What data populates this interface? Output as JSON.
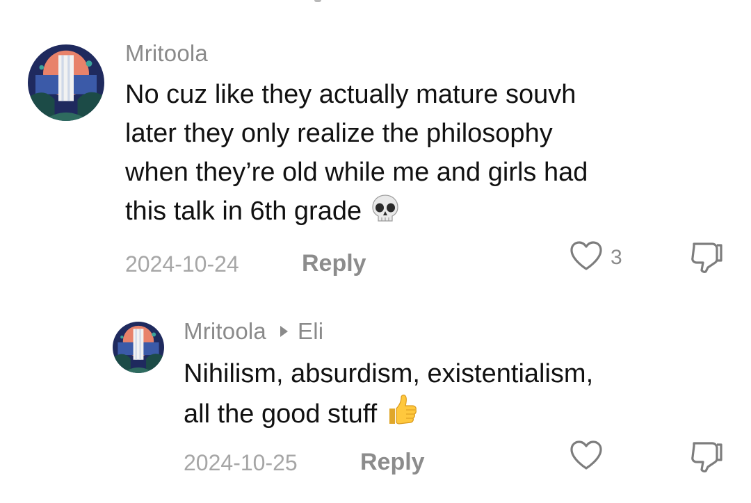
{
  "comment": {
    "username": "Mritoola",
    "text_lines": [
      "No cuz like they actually mature souvh",
      "later they only realize the philosophy",
      "when they’re old while me and girls had",
      "this talk in 6th grade"
    ],
    "emoji": "skull-emoji",
    "date": "2024-10-24",
    "reply_label": "Reply",
    "like_count": "3",
    "icons": {
      "like": "heart-icon",
      "dislike": "thumbs-down-icon"
    }
  },
  "reply": {
    "username": "Mritoola",
    "reply_to": "Eli",
    "text_lines": [
      "Nihilism, absurdism, existentialism,",
      "all the good stuff"
    ],
    "emoji": "thumbs-up-emoji",
    "date": "2024-10-25",
    "reply_label": "Reply",
    "icons": {
      "like": "heart-icon",
      "dislike": "thumbs-down-icon"
    }
  },
  "colors": {
    "meta_gray": "#8a8a8a",
    "date_gray": "#a6a6a6",
    "text": "#111111"
  }
}
